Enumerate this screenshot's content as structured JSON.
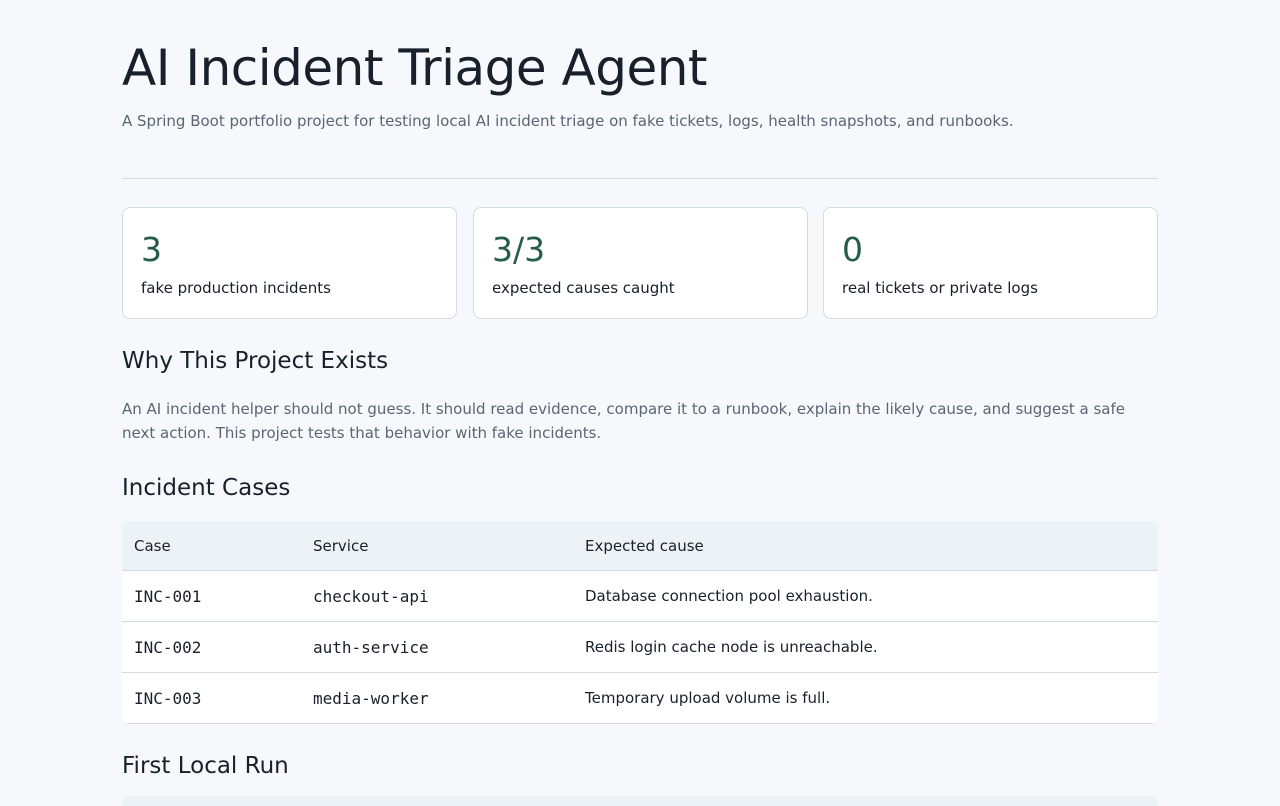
{
  "header": {
    "title": "AI Incident Triage Agent",
    "subtitle": "A Spring Boot portfolio project for testing local AI incident triage on fake tickets, logs, health snapshots, and runbooks."
  },
  "stats": [
    {
      "value": "3",
      "label": "fake production incidents"
    },
    {
      "value": "3/3",
      "label": "expected causes caught"
    },
    {
      "value": "0",
      "label": "real tickets or private logs"
    }
  ],
  "why": {
    "heading": "Why This Project Exists",
    "text": "An AI incident helper should not guess. It should read evidence, compare it to a runbook, explain the likely cause, and suggest a safe next action. This project tests that behavior with fake incidents."
  },
  "cases": {
    "heading": "Incident Cases",
    "columns": [
      "Case",
      "Service",
      "Expected cause"
    ],
    "rows": [
      {
        "case": "INC-001",
        "service": "checkout-api",
        "cause": "Database connection pool exhaustion."
      },
      {
        "case": "INC-002",
        "service": "auth-service",
        "cause": "Redis login cache node is unreachable."
      },
      {
        "case": "INC-003",
        "service": "media-worker",
        "cause": "Temporary upload volume is full."
      }
    ]
  },
  "run": {
    "heading": "First Local Run"
  },
  "colors": {
    "background": "#f6f8fb",
    "accent": "#245c47",
    "text": "#18202b",
    "muted": "#5a6675",
    "border": "#d5dbe2",
    "table_header": "#edf2f6"
  }
}
